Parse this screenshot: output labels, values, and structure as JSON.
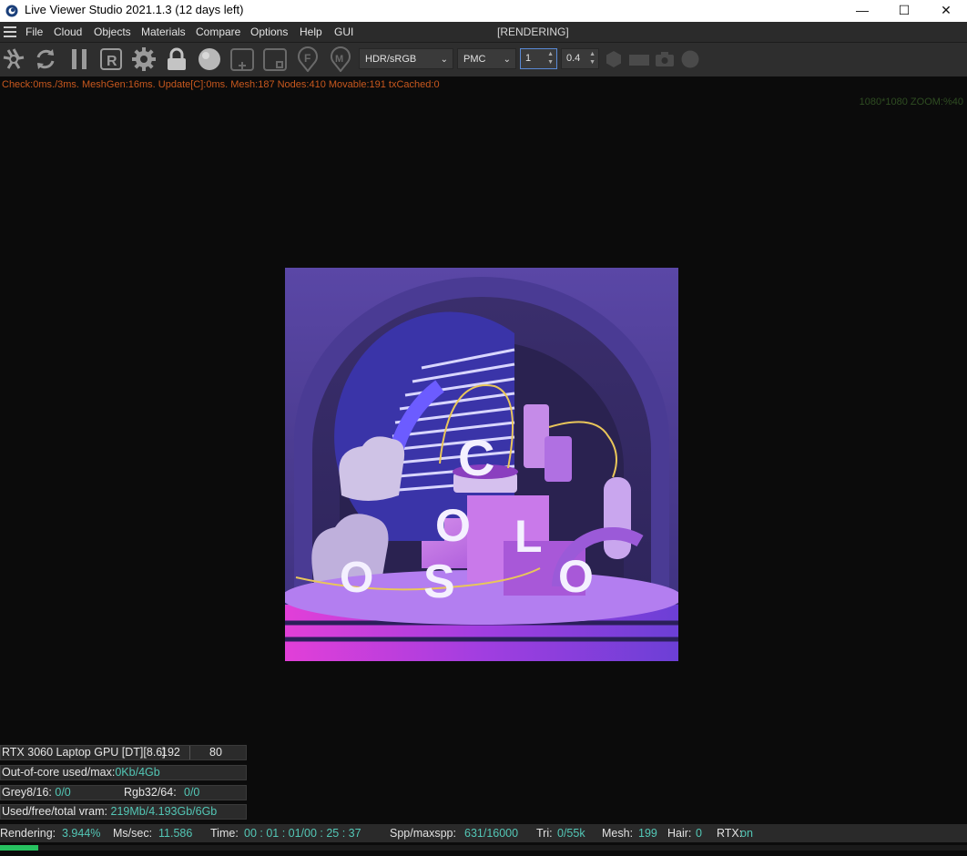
{
  "window": {
    "title": "Live Viewer Studio 2021.1.3 (12 days left)",
    "minimize_glyph": "—",
    "maximize_glyph": "☐",
    "close_glyph": "✕"
  },
  "menu": {
    "items": [
      "File",
      "Cloud",
      "Objects",
      "Materials",
      "Compare",
      "Options",
      "Help",
      "GUI"
    ],
    "render_state": "[RENDERING]"
  },
  "toolbar": {
    "icons": [
      "aperture-icon",
      "refresh-icon",
      "pause-icon",
      "r-icon",
      "gear-icon",
      "lock-icon",
      "sphere-icon",
      "add-region-icon",
      "focus-region-icon",
      "f-pin-icon",
      "m-pin-icon"
    ],
    "colorspace": "HDR/sRGB",
    "kernel": "PMC",
    "spin1": "1",
    "spin2": "0.4"
  },
  "stats_line": "Check:0ms./3ms. MeshGen:16ms. Update[C]:0ms. Mesh:187 Nodes:410 Movable:191 txCached:0",
  "zoom_info": "1080*1080 ZOOM:%40",
  "info_panel": {
    "gpu_label": "RTX 3060 Laptop GPU [DT][8.6]",
    "gpu_mem": "192",
    "gpu_temp": "80",
    "ooc_label": "Out-of-core used/max:",
    "ooc_value": "0Kb/4Gb",
    "grey_label": "Grey8/16:",
    "grey_value": "0/0",
    "rgb_label": "Rgb32/64:",
    "rgb_value": "0/0",
    "vram_label": "Used/free/total vram:",
    "vram_value": "219Mb/4.193Gb/6Gb"
  },
  "status": {
    "rendering_label": "Rendering:",
    "rendering_value": "3.944%",
    "ms_label": "Ms/sec:",
    "ms_value": "11.586",
    "time_label": "Time:",
    "time_value": "00 : 01 : 01/00 : 25 : 37",
    "spp_label": "Spp/maxspp:",
    "spp_value": "631/16000",
    "tri_label": "Tri:",
    "tri_value": "0/55k",
    "mesh_label": "Mesh:",
    "mesh_value": "199",
    "hair_label": "Hair:",
    "hair_value": "0",
    "rtx_label": "RTX:",
    "rtx_value": "on"
  },
  "progress_fraction": 0.03944,
  "render_letters": [
    "C",
    "O",
    "L",
    "O",
    "S",
    "O"
  ],
  "colors": {
    "accent_value": "#53c7b6",
    "stats_orange": "#c8581e",
    "progress_green": "#27c160",
    "scene_purple": "#4b3a8f",
    "scene_magenta": "#d93fd6"
  }
}
